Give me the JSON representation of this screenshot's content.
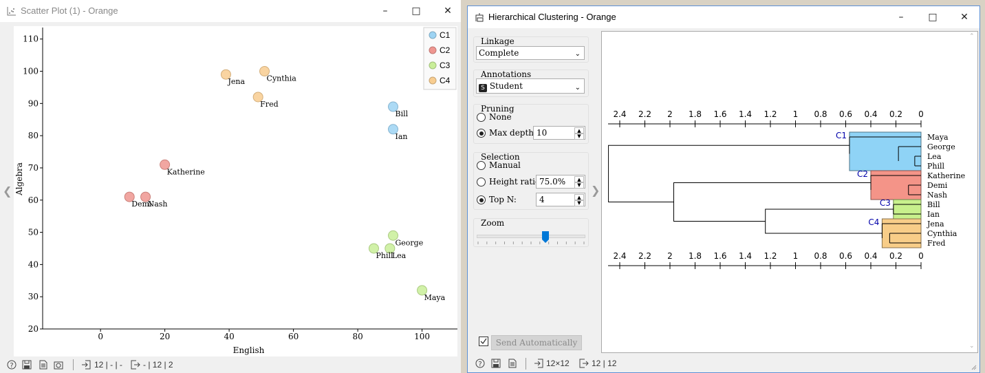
{
  "scatter": {
    "title": "Scatter Plot (1) - Orange",
    "xlabel": "English",
    "ylabel": "Algebra",
    "legend": [
      {
        "label": "C1",
        "color": "#9dd3f3"
      },
      {
        "label": "C2",
        "color": "#ef9690"
      },
      {
        "label": "C3",
        "color": "#c9ee99"
      },
      {
        "label": "C4",
        "color": "#f8cd90"
      }
    ],
    "status": {
      "input": "12 | - | -",
      "output": "- | 12 | 2"
    }
  },
  "chart_data": {
    "type": "scatter",
    "xlabel": "English",
    "ylabel": "Algebra",
    "xlim": [
      -18,
      111
    ],
    "ylim": [
      20,
      114
    ],
    "xticks": [
      0,
      20,
      40,
      60,
      80,
      100
    ],
    "yticks": [
      20,
      30,
      40,
      50,
      60,
      70,
      80,
      90,
      100,
      110
    ],
    "grid": false,
    "legend_position": "top-right",
    "series": [
      {
        "name": "C1",
        "color": "#9dd3f3",
        "points": [
          {
            "label": "Bill",
            "x": 91,
            "y": 89
          },
          {
            "label": "Ian",
            "x": 91,
            "y": 82
          }
        ]
      },
      {
        "name": "C2",
        "color": "#ef9690",
        "points": [
          {
            "label": "Katherine",
            "x": 20,
            "y": 71
          },
          {
            "label": "Demi",
            "x": 9,
            "y": 61
          },
          {
            "label": "Nash",
            "x": 14,
            "y": 61
          }
        ]
      },
      {
        "name": "C3",
        "color": "#c9ee99",
        "points": [
          {
            "label": "George",
            "x": 91,
            "y": 49
          },
          {
            "label": "Phill",
            "x": 85,
            "y": 45
          },
          {
            "label": "Lea",
            "x": 90,
            "y": 45
          },
          {
            "label": "Maya",
            "x": 100,
            "y": 32
          }
        ]
      },
      {
        "name": "C4",
        "color": "#f8cd90",
        "points": [
          {
            "label": "Jena",
            "x": 39,
            "y": 99
          },
          {
            "label": "Cynthia",
            "x": 51,
            "y": 100
          },
          {
            "label": "Fred",
            "x": 49,
            "y": 92
          }
        ]
      }
    ]
  },
  "hc": {
    "title": "Hierarchical Clustering - Orange",
    "linkage": {
      "label": "Linkage",
      "value": "Complete"
    },
    "annotations": {
      "label": "Annotations",
      "value": "Student",
      "badge": "S"
    },
    "pruning": {
      "label": "Pruning",
      "none_label": "None",
      "max_depth_label": "Max depth:",
      "max_depth_value": "10"
    },
    "selection": {
      "label": "Selection",
      "manual_label": "Manual",
      "height_ratio_label": "Height ratio:",
      "height_ratio_value": "75.0%",
      "top_n_label": "Top N:",
      "top_n_value": "4"
    },
    "zoom": {
      "label": "Zoom",
      "value_fraction": 0.64
    },
    "send_auto_label": "Send Automatically",
    "status": {
      "input": "12×12",
      "output": "12 | 12"
    },
    "axis_ticks": [
      "2.4",
      "2.2",
      "2",
      "1.8",
      "1.6",
      "1.4",
      "1.2",
      "1",
      "0.8",
      "0.6",
      "0.4",
      "0.2",
      "0"
    ],
    "leaves": [
      "Maya",
      "George",
      "Lea",
      "Phill",
      "Katherine",
      "Demi",
      "Nash",
      "Bill",
      "Ian",
      "Jena",
      "Cynthia",
      "Fred"
    ],
    "clusters": [
      {
        "label": "C1",
        "color": "#8fd3f6",
        "first": 0,
        "last": 3,
        "height": 0.57
      },
      {
        "label": "C2",
        "color": "#f49488",
        "first": 4,
        "last": 6,
        "height": 0.4
      },
      {
        "label": "C3",
        "color": "#c8f08c",
        "first": 7,
        "last": 8,
        "height": 0.22
      },
      {
        "label": "C4",
        "color": "#f8cd88",
        "first": 9,
        "last": 11,
        "height": 0.31
      }
    ]
  }
}
